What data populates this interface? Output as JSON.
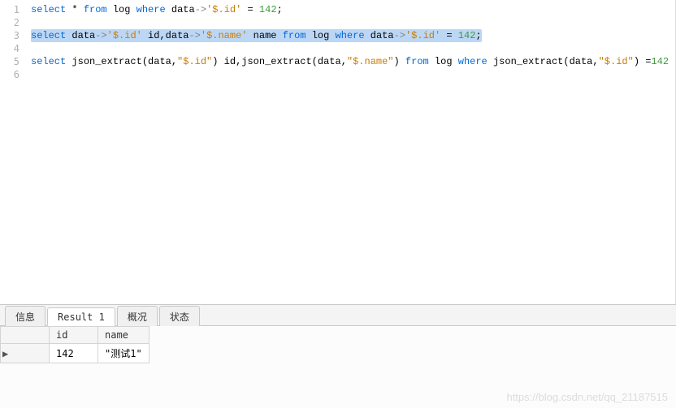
{
  "editor": {
    "line_numbers": [
      "1",
      "2",
      "3",
      "4",
      "5",
      "6"
    ],
    "lines": [
      [
        {
          "t": "select",
          "c": "kw"
        },
        {
          "t": " * ",
          "c": "ident"
        },
        {
          "t": "from",
          "c": "kw"
        },
        {
          "t": " log ",
          "c": "ident"
        },
        {
          "t": "where",
          "c": "kw"
        },
        {
          "t": " data",
          "c": "ident"
        },
        {
          "t": "->",
          "c": "op"
        },
        {
          "t": "'$.id'",
          "c": "str"
        },
        {
          "t": " = ",
          "c": "ident"
        },
        {
          "t": "142",
          "c": "num"
        },
        {
          "t": ";",
          "c": "punct"
        }
      ],
      [],
      [
        {
          "t": "select",
          "c": "kw",
          "sel": true
        },
        {
          "t": " data",
          "c": "ident",
          "sel": true
        },
        {
          "t": "->",
          "c": "op",
          "sel": true
        },
        {
          "t": "'$.id'",
          "c": "str",
          "sel": true
        },
        {
          "t": " id,data",
          "c": "ident",
          "sel": true
        },
        {
          "t": "->",
          "c": "op",
          "sel": true
        },
        {
          "t": "'$.name'",
          "c": "str",
          "sel": true
        },
        {
          "t": " name ",
          "c": "ident",
          "sel": true
        },
        {
          "t": "from",
          "c": "kw",
          "sel": true
        },
        {
          "t": " log ",
          "c": "ident",
          "sel": true
        },
        {
          "t": "where",
          "c": "kw",
          "sel": true
        },
        {
          "t": " data",
          "c": "ident",
          "sel": true
        },
        {
          "t": "->",
          "c": "op",
          "sel": true
        },
        {
          "t": "'$.id'",
          "c": "str",
          "sel": true
        },
        {
          "t": " = ",
          "c": "ident",
          "sel": true
        },
        {
          "t": "142",
          "c": "num",
          "sel": true
        },
        {
          "t": ";",
          "c": "punct",
          "sel": true
        }
      ],
      [],
      [
        {
          "t": "select",
          "c": "kw"
        },
        {
          "t": " json_extract(data,",
          "c": "ident"
        },
        {
          "t": "\"$.id\"",
          "c": "str"
        },
        {
          "t": ") id,json_extract(data,",
          "c": "ident"
        },
        {
          "t": "\"$.name\"",
          "c": "str"
        },
        {
          "t": ") ",
          "c": "ident"
        },
        {
          "t": "from",
          "c": "kw"
        },
        {
          "t": " log ",
          "c": "ident"
        },
        {
          "t": "where",
          "c": "kw"
        },
        {
          "t": " json_extract(data,",
          "c": "ident"
        },
        {
          "t": "\"$.id\"",
          "c": "str"
        },
        {
          "t": ") =",
          "c": "ident"
        },
        {
          "t": "142",
          "c": "num"
        }
      ],
      []
    ]
  },
  "tabs": {
    "items": [
      {
        "label": "信息",
        "active": false
      },
      {
        "label": "Result 1",
        "active": true
      },
      {
        "label": "概况",
        "active": false
      },
      {
        "label": "状态",
        "active": false
      }
    ]
  },
  "result": {
    "columns": [
      "id",
      "name"
    ],
    "rows": [
      {
        "marker": "▶",
        "cells": [
          "142",
          "\"测试1\""
        ]
      }
    ]
  },
  "watermark": "https://blog.csdn.net/qq_21187515"
}
